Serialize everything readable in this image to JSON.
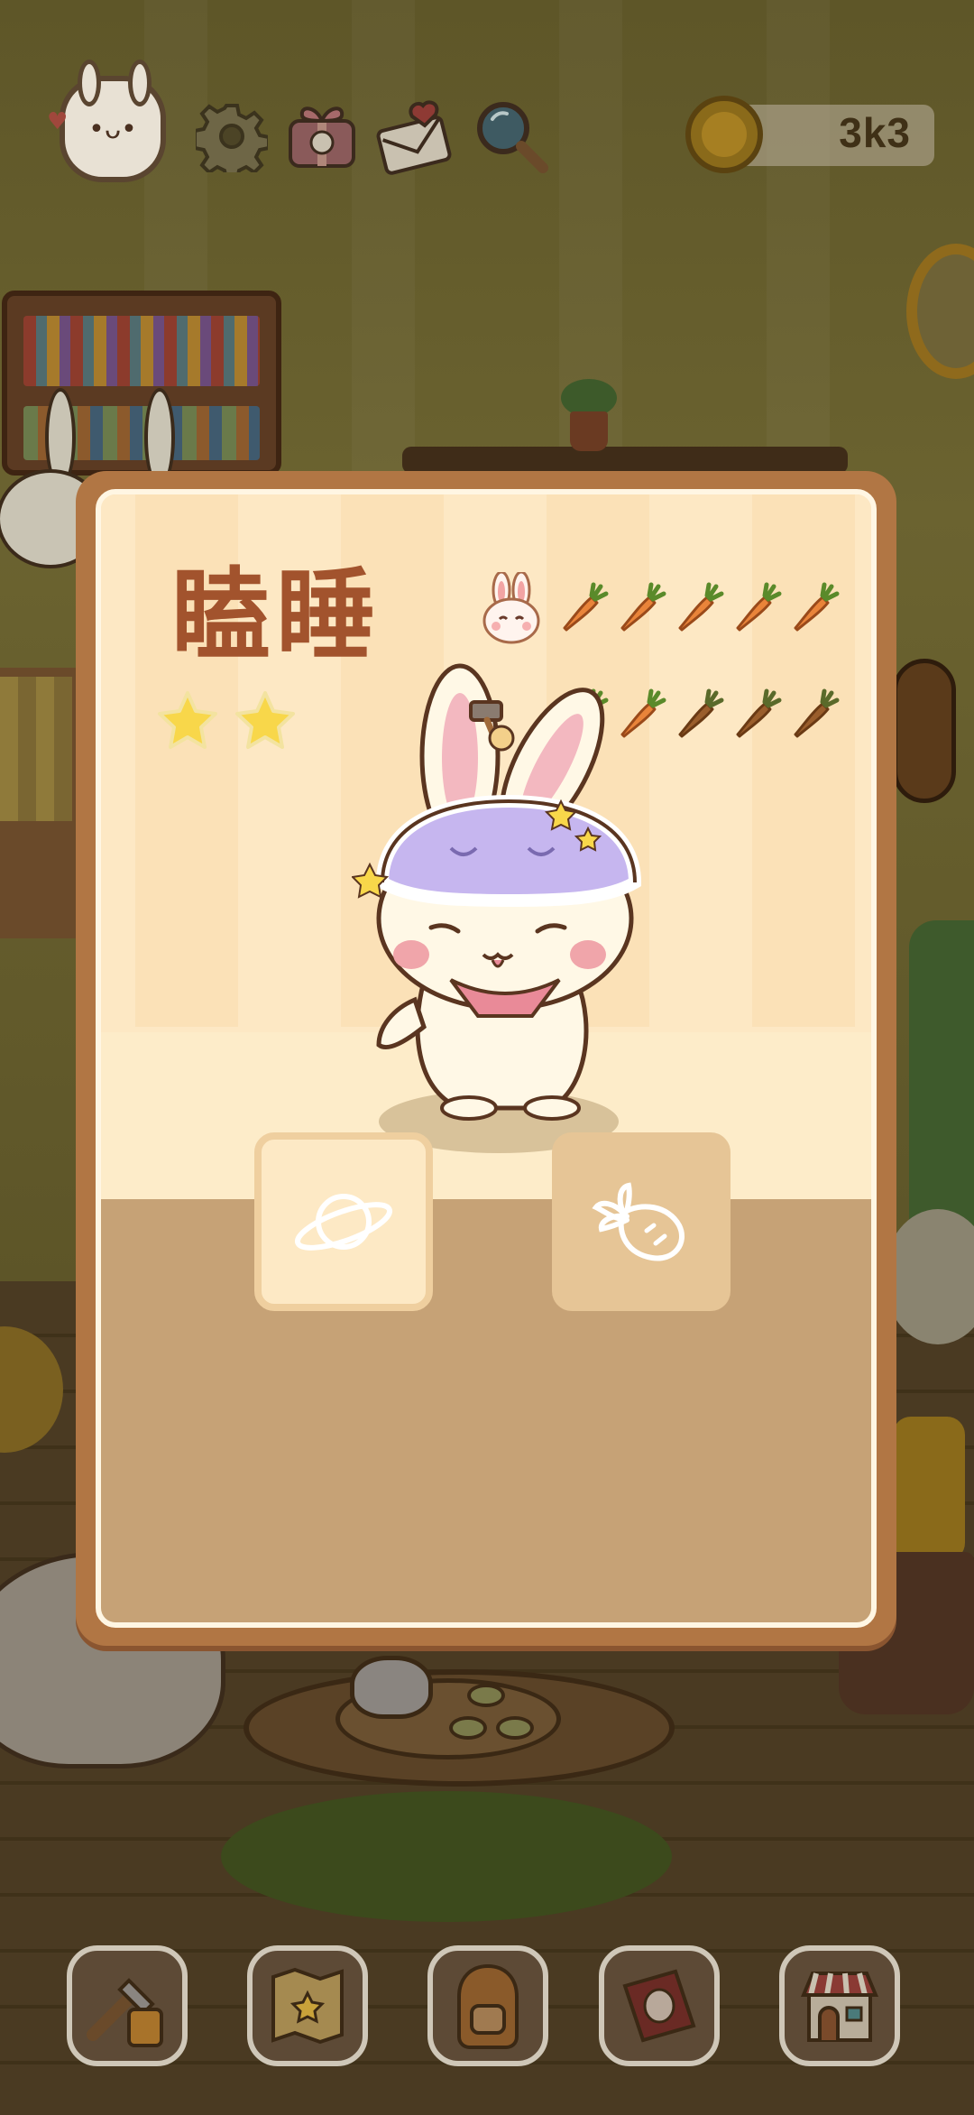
{
  "header": {
    "coin_amount": "3k3",
    "icons": {
      "avatar": "bunny-avatar-icon",
      "settings": "gear-icon",
      "gift": "gift-icon",
      "mail": "love-letter-icon",
      "search": "magnifier-icon",
      "coin": "bunny-coin-icon"
    }
  },
  "card": {
    "title": "瞌睡",
    "rarity_stars": 2,
    "carrot_rows": [
      {
        "filled": 5,
        "total": 5
      },
      {
        "filled": 2,
        "total": 5
      }
    ],
    "character": "sleepy-bunny-with-eye-mask",
    "buttons": [
      {
        "name": "planet-button",
        "icon": "planet-icon"
      },
      {
        "name": "carrot-button",
        "icon": "carrot-icon"
      }
    ]
  },
  "bottom_nav": [
    {
      "name": "nav-tools",
      "icon": "tools-icon"
    },
    {
      "name": "nav-map",
      "icon": "treasure-map-icon"
    },
    {
      "name": "nav-backpack",
      "icon": "backpack-icon"
    },
    {
      "name": "nav-album",
      "icon": "bunny-album-icon"
    },
    {
      "name": "nav-shop",
      "icon": "shop-icon"
    }
  ],
  "colors": {
    "card_border": "#b17644",
    "card_bg": "#f7e3be",
    "title": "#a2532d",
    "carrot_filled": "#e9843a",
    "carrot_empty": "#9a5e2c",
    "star": "#f8d74a"
  }
}
